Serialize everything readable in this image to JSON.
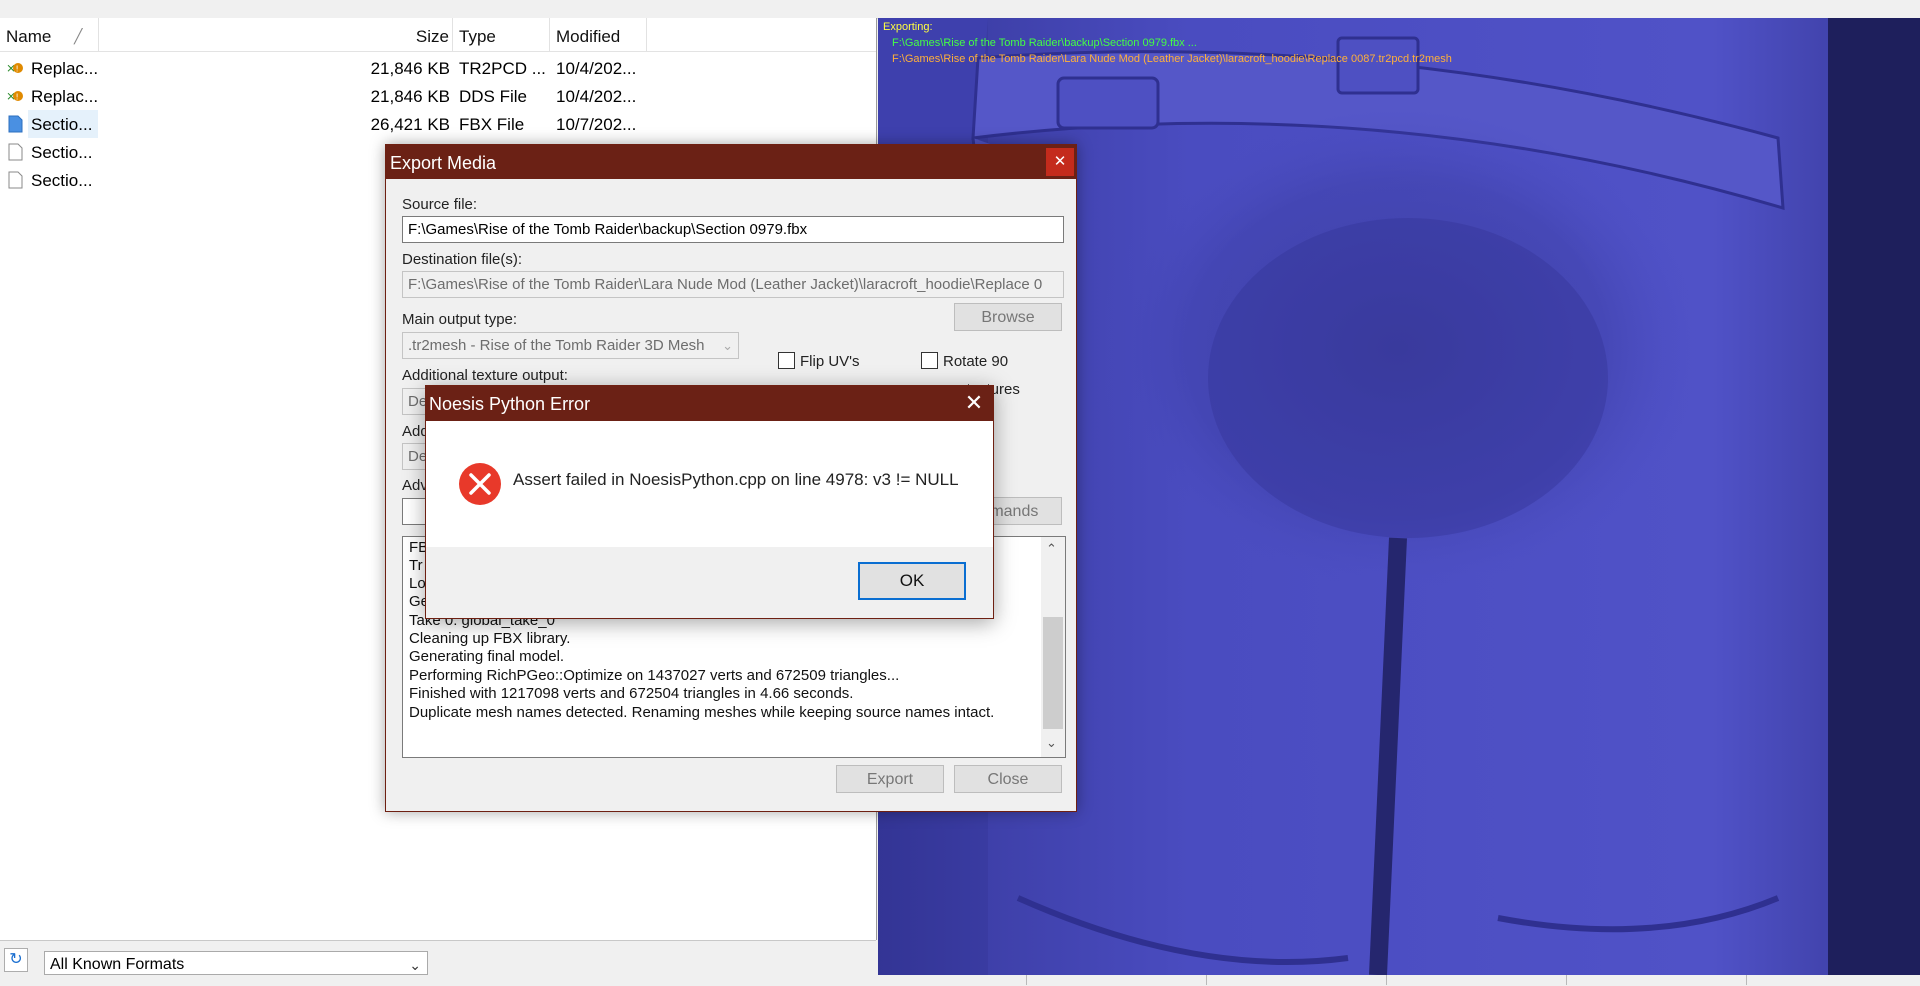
{
  "file_list": {
    "headers": {
      "name": "Name",
      "size": "Size",
      "type": "Type",
      "modified": "Modified"
    },
    "rows": [
      {
        "name": "Replac...",
        "size": "21,846 KB",
        "type": "TR2PCD ...",
        "modified": "10/4/202...",
        "icon": "patch-icon"
      },
      {
        "name": "Replac...",
        "size": "21,846 KB",
        "type": "DDS File",
        "modified": "10/4/202...",
        "icon": "patch-icon"
      },
      {
        "name": "Sectio...",
        "size": "26,421 KB",
        "type": "FBX File",
        "modified": "10/7/202...",
        "icon": "fbx-file-icon"
      },
      {
        "name": "Sectio...",
        "size": "",
        "type": "",
        "modified": "",
        "icon": "file-icon"
      },
      {
        "name": "Sectio...",
        "size": "",
        "type": "",
        "modified": "",
        "icon": "file-icon"
      }
    ]
  },
  "format_filter": {
    "selected": "All Known Formats"
  },
  "viewport": {
    "title": "Exporting:",
    "source_path": "F:\\Games\\Rise of the Tomb Raider\\backup\\Section 0979.fbx ...",
    "dest_path": "F:\\Games\\Rise of the Tomb Raider\\Lara Nude Mod (Leather Jacket)\\laracroft_hoodie\\Replace 0087.tr2pcd.tr2mesh",
    "colors": {
      "background": "#4a4cc0",
      "title": "#ffff40",
      "source": "#44ff44",
      "dest": "#ffb03a"
    }
  },
  "export_dialog": {
    "title": "Export Media",
    "close_glyph": "✕",
    "source_label": "Source file:",
    "source_value": "F:\\Games\\Rise of the Tomb Raider\\backup\\Section 0979.fbx",
    "dest_label": "Destination file(s):",
    "dest_value": "F:\\Games\\Rise of the Tomb Raider\\Lara Nude Mod (Leather Jacket)\\laracroft_hoodie\\Replace 0",
    "browse_label": "Browse",
    "main_output_label": "Main output type:",
    "main_output_value": ".tr2mesh - Rise of the Tomb Raider 3D Mesh",
    "additional_texture_label": "Additional texture output:",
    "add_texture_partial": "De",
    "add_label_partial": "Add",
    "add_value_partial": "De",
    "adv_label_partial": "Adv",
    "commands_partial": "mmands",
    "flip_uvs_label": "Flip UV's",
    "rotate_90_label": "Rotate 90",
    "no_textures_partial": "o textures",
    "log_lines": [
      "FB",
      "Tr",
      "Lo",
      "Ge",
      "Take 0: global_take_0",
      "Cleaning up FBX library.",
      "Generating final model.",
      "Performing RichPGeo::Optimize on 1437027 verts and 672509 triangles...",
      "Finished with 1217098 verts and 672504 triangles in 4.66 seconds.",
      "Duplicate mesh names detected. Renaming meshes while keeping source names intact."
    ],
    "export_label": "Export",
    "close_label": "Close"
  },
  "error_dialog": {
    "title": "Noesis Python Error",
    "close_glyph": "✕",
    "message": "Assert failed in NoesisPython.cpp on line 4978: v3 != NULL",
    "ok_label": "OK",
    "error_color": "#e8392a"
  }
}
